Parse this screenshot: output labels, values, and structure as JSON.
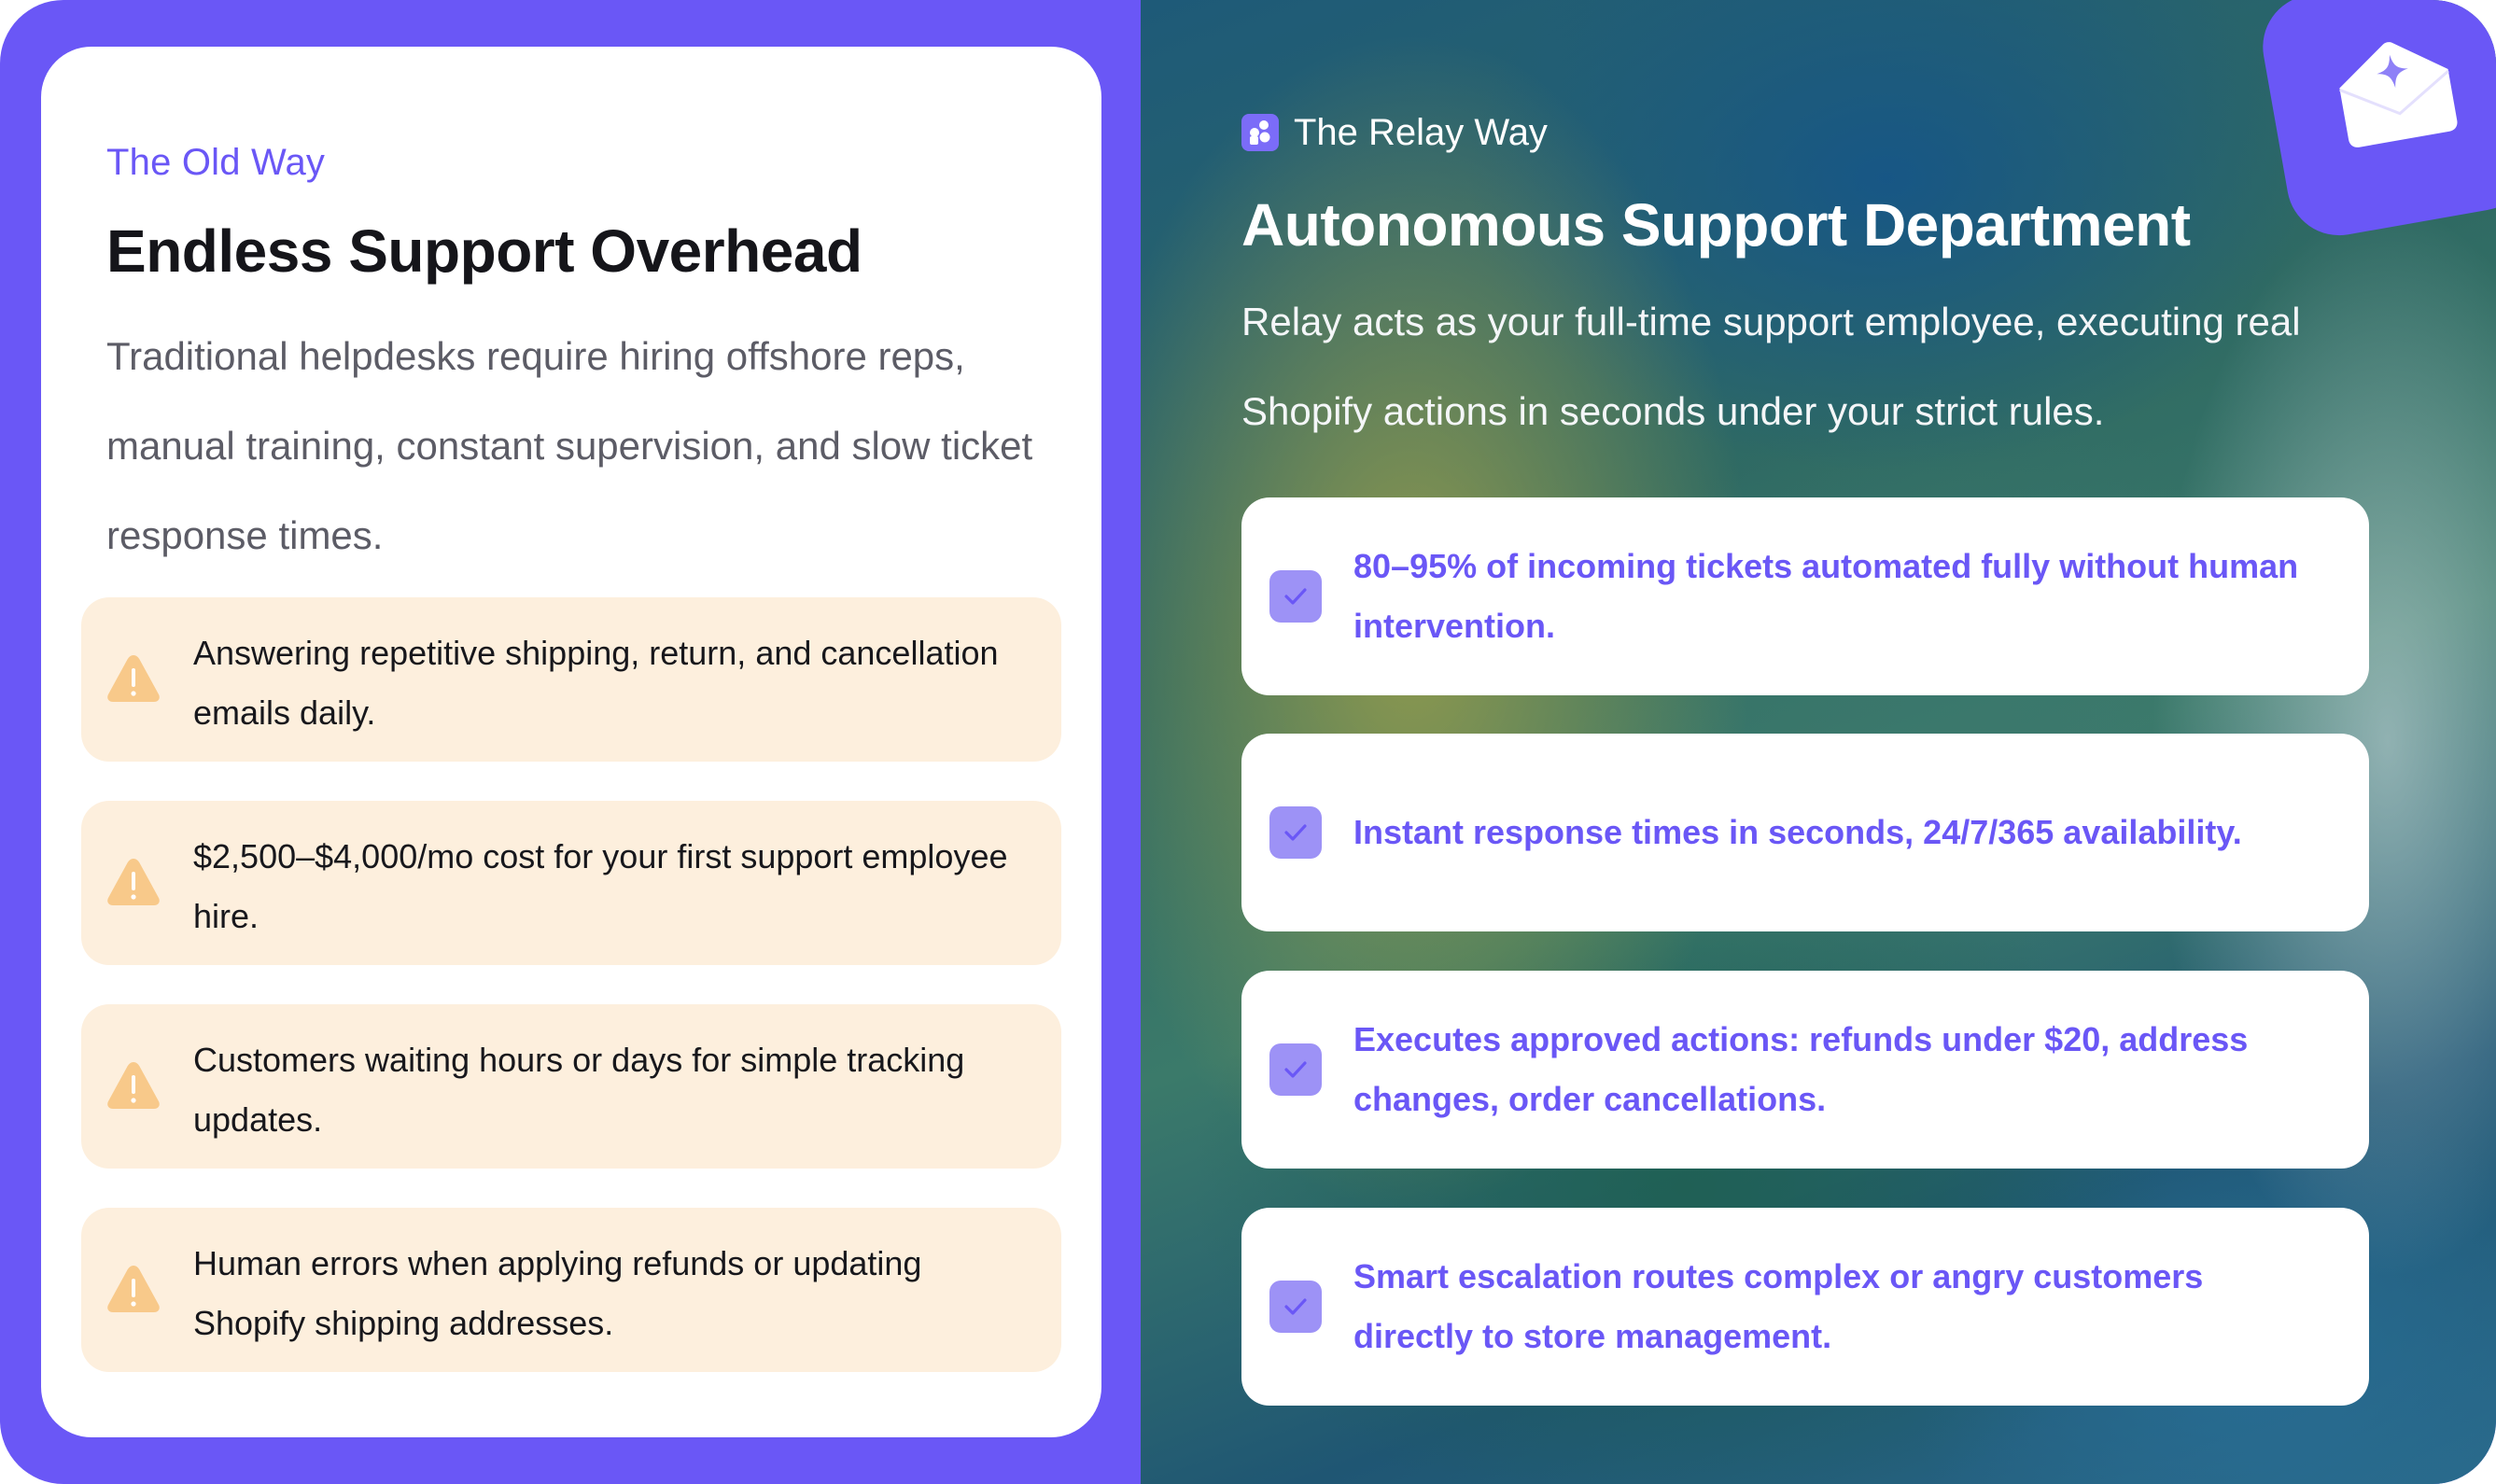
{
  "old_way": {
    "kicker": "The Old Way",
    "title": "Endless Support Overhead",
    "description": "Traditional helpdesks require hiring offshore reps, manual training, constant supervision, and slow ticket response times.",
    "pains": [
      {
        "text": "Answering repetitive shipping, return, and cancellation emails daily.",
        "icon": "warning-icon"
      },
      {
        "text": "$2,500–$4,000/mo cost for your first support employee hire.",
        "icon": "warning-icon"
      },
      {
        "text": "Customers waiting hours or days for simple tracking updates.",
        "icon": "warning-icon"
      },
      {
        "text": "Human errors when applying refunds or updating Shopify shipping addresses.",
        "icon": "warning-icon"
      }
    ]
  },
  "relay_way": {
    "kicker": "The Relay Way",
    "title": "Autonomous Support Department",
    "description": "Relay acts as your full-time support employee, executing real Shopify actions in seconds under your strict rules.",
    "benefits": [
      {
        "text": "80–95% of incoming tickets automated fully without human intervention.",
        "icon": "check-icon"
      },
      {
        "text": "Instant response times in seconds, 24/7/365 availability.",
        "icon": "check-icon"
      },
      {
        "text": "Executes approved actions: refunds under $20, address changes, order cancellations.",
        "icon": "check-icon"
      },
      {
        "text": "Smart escalation routes complex or angry customers directly to store management.",
        "icon": "check-icon"
      }
    ]
  },
  "colors": {
    "accent": "#6a57f6",
    "pain_bg": "#fdefdd",
    "warning": "#f8c98a",
    "check_bg": "#9d92f6"
  }
}
